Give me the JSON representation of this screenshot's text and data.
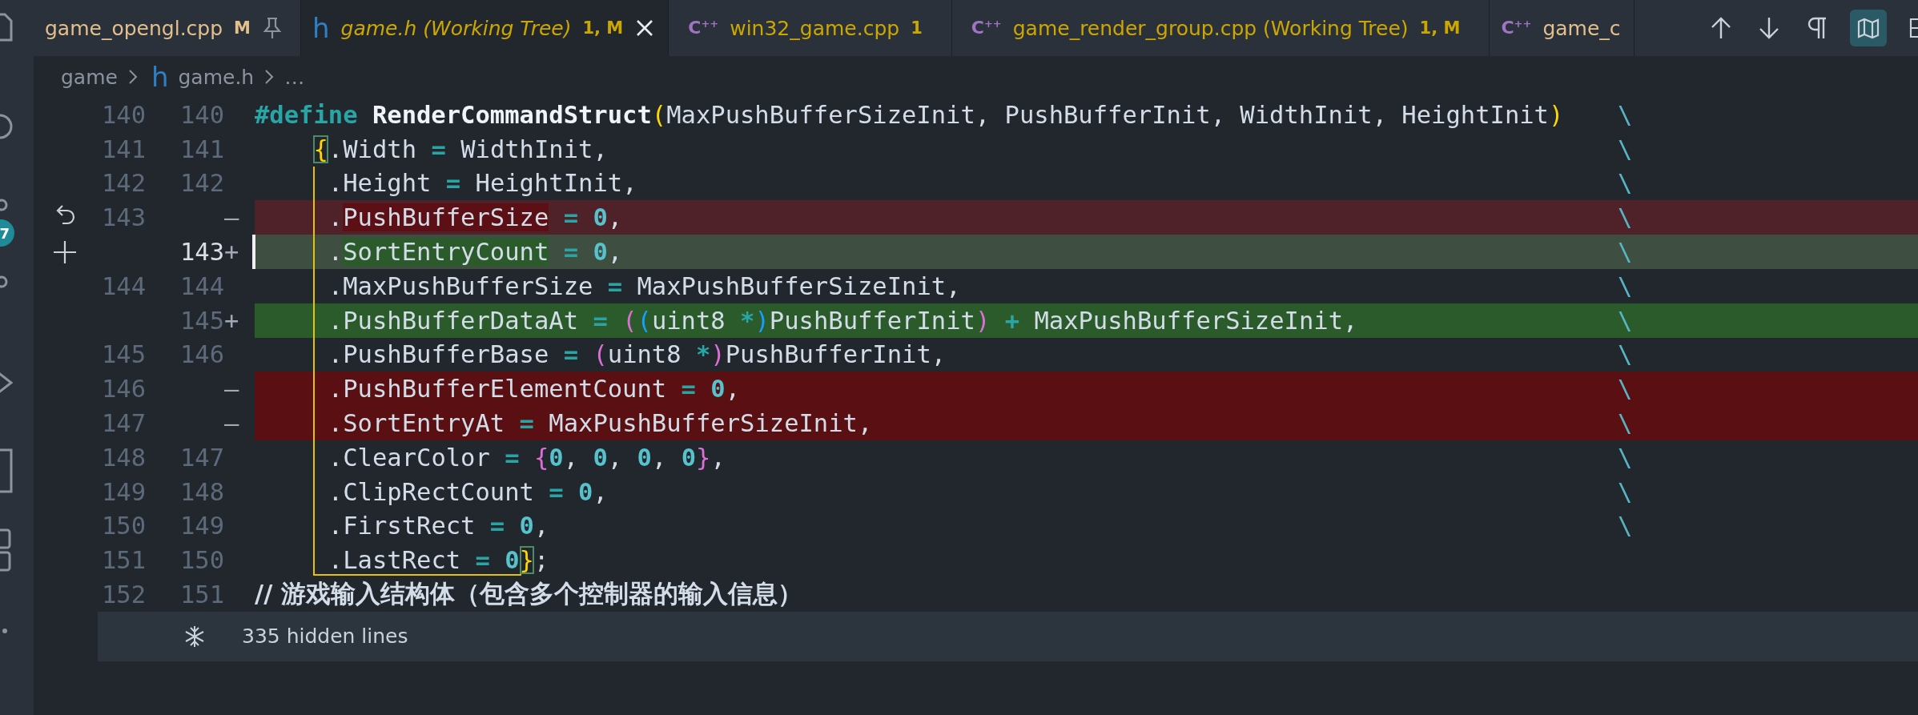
{
  "activity_bar": {
    "badge": "7"
  },
  "tabs": [
    {
      "label": "game_opengl.cpp",
      "badge": "M",
      "kind": "modified",
      "preview": false,
      "pinned": true,
      "selected": false
    },
    {
      "file_icon": "h",
      "label": "game.h (Working Tree)",
      "badge": "1, M",
      "kind": "warning",
      "preview": true,
      "pinned": false,
      "selected": true
    },
    {
      "file_icon": "C$^{++}$",
      "label": "win32_game.cpp",
      "badge": "1",
      "kind": "warning",
      "preview": false,
      "pinned": false,
      "selected": false
    },
    {
      "file_icon": "C$^{++}$",
      "label": "game_render_group.cpp (Working Tree)",
      "badge": "1, M",
      "kind": "warning",
      "preview": false,
      "pinned": false,
      "selected": false
    },
    {
      "file_icon": "C$^{++}$",
      "label": "game_c",
      "kind": "modified",
      "preview": false,
      "pinned": false,
      "selected": false
    }
  ],
  "actions": [
    {
      "kind": "arrow-up",
      "selected": false
    },
    {
      "kind": "arrow-down",
      "selected": false
    },
    {
      "kind": "pilcrow",
      "selected": false
    },
    {
      "kind": "map",
      "selected": true
    },
    {
      "kind": "split",
      "selected": false
    }
  ],
  "breadcrumb": [
    {
      "label": "game"
    },
    {
      "label": "game.h",
      "file_icon": "h"
    },
    {
      "label": "…"
    }
  ],
  "lines": [
    {
      "old": "140",
      "new": "140",
      "kind": "context",
      "cursor": false,
      "cont": "\\",
      "text": "#define RenderCommandStruct(MaxPushBufferSizeInit, PushBufferInit, WidthInit, HeightInit)"
    },
    {
      "old": "141",
      "new": "141",
      "kind": "context",
      "cursor": false,
      "cont": "\\",
      "text": "    {.Width = WidthInit,"
    },
    {
      "old": "142",
      "new": "142",
      "kind": "context",
      "cursor": false,
      "cont": "\\",
      "text": "     .Height = HeightInit,"
    },
    {
      "old": "143",
      "sign": "—",
      "kind": "removed",
      "whole": false,
      "cursor": false,
      "gutter": {
        "kind": "revert"
      },
      "cont": "\\",
      "segments": [
        {
          "text": "     .",
          "changed": false
        },
        {
          "text": "PushBufferSize",
          "changed": true
        },
        {
          "text": " = 0,",
          "changed": false
        }
      ]
    },
    {
      "new": "143",
      "sign": "+",
      "kind": "added",
      "whole": false,
      "cursor": true,
      "gutter": {
        "kind": "plus"
      },
      "cont": "\\",
      "segments": [
        {
          "text": "     .",
          "changed": false
        },
        {
          "text": "SortEntryCount",
          "changed": true
        },
        {
          "text": " = 0,",
          "changed": false
        }
      ]
    },
    {
      "old": "144",
      "new": "144",
      "kind": "context",
      "cursor": false,
      "cont": "\\",
      "text": "     .MaxPushBufferSize = MaxPushBufferSizeInit,"
    },
    {
      "new": "145",
      "sign": "+",
      "kind": "added",
      "whole": true,
      "cursor": false,
      "cont": "\\",
      "text": "     .PushBufferDataAt = ((uint8 *)PushBufferInit) + MaxPushBufferSizeInit,"
    },
    {
      "old": "145",
      "new": "146",
      "kind": "context",
      "cursor": false,
      "cont": "\\",
      "text": "     .PushBufferBase = (uint8 *)PushBufferInit,"
    },
    {
      "old": "146",
      "sign": "—",
      "kind": "removed",
      "whole": true,
      "cursor": false,
      "cont": "\\",
      "text": "     .PushBufferElementCount = 0,"
    },
    {
      "old": "147",
      "sign": "—",
      "kind": "removed",
      "whole": true,
      "cursor": false,
      "cont": "\\",
      "text": "     .SortEntryAt = MaxPushBufferSizeInit,"
    },
    {
      "old": "148",
      "new": "147",
      "kind": "context",
      "cursor": false,
      "cont": "\\",
      "text": "     .ClearColor = {0, 0, 0, 0},"
    },
    {
      "old": "149",
      "new": "148",
      "kind": "context",
      "cursor": false,
      "cont": "\\",
      "text": "     .ClipRectCount = 0,"
    },
    {
      "old": "150",
      "new": "149",
      "kind": "context",
      "cursor": false,
      "cont": "\\",
      "text": "     .FirstRect = 0,"
    },
    {
      "old": "151",
      "new": "150",
      "kind": "context",
      "cursor": false,
      "text": "     .LastRect = 0};"
    },
    {
      "old": "152",
      "new": "151",
      "kind": "context",
      "cursor": false,
      "text": "// 游戏输入结构体（包含多个控制器的输入信息）"
    }
  ],
  "folded": {
    "text": "335 hidden lines"
  }
}
